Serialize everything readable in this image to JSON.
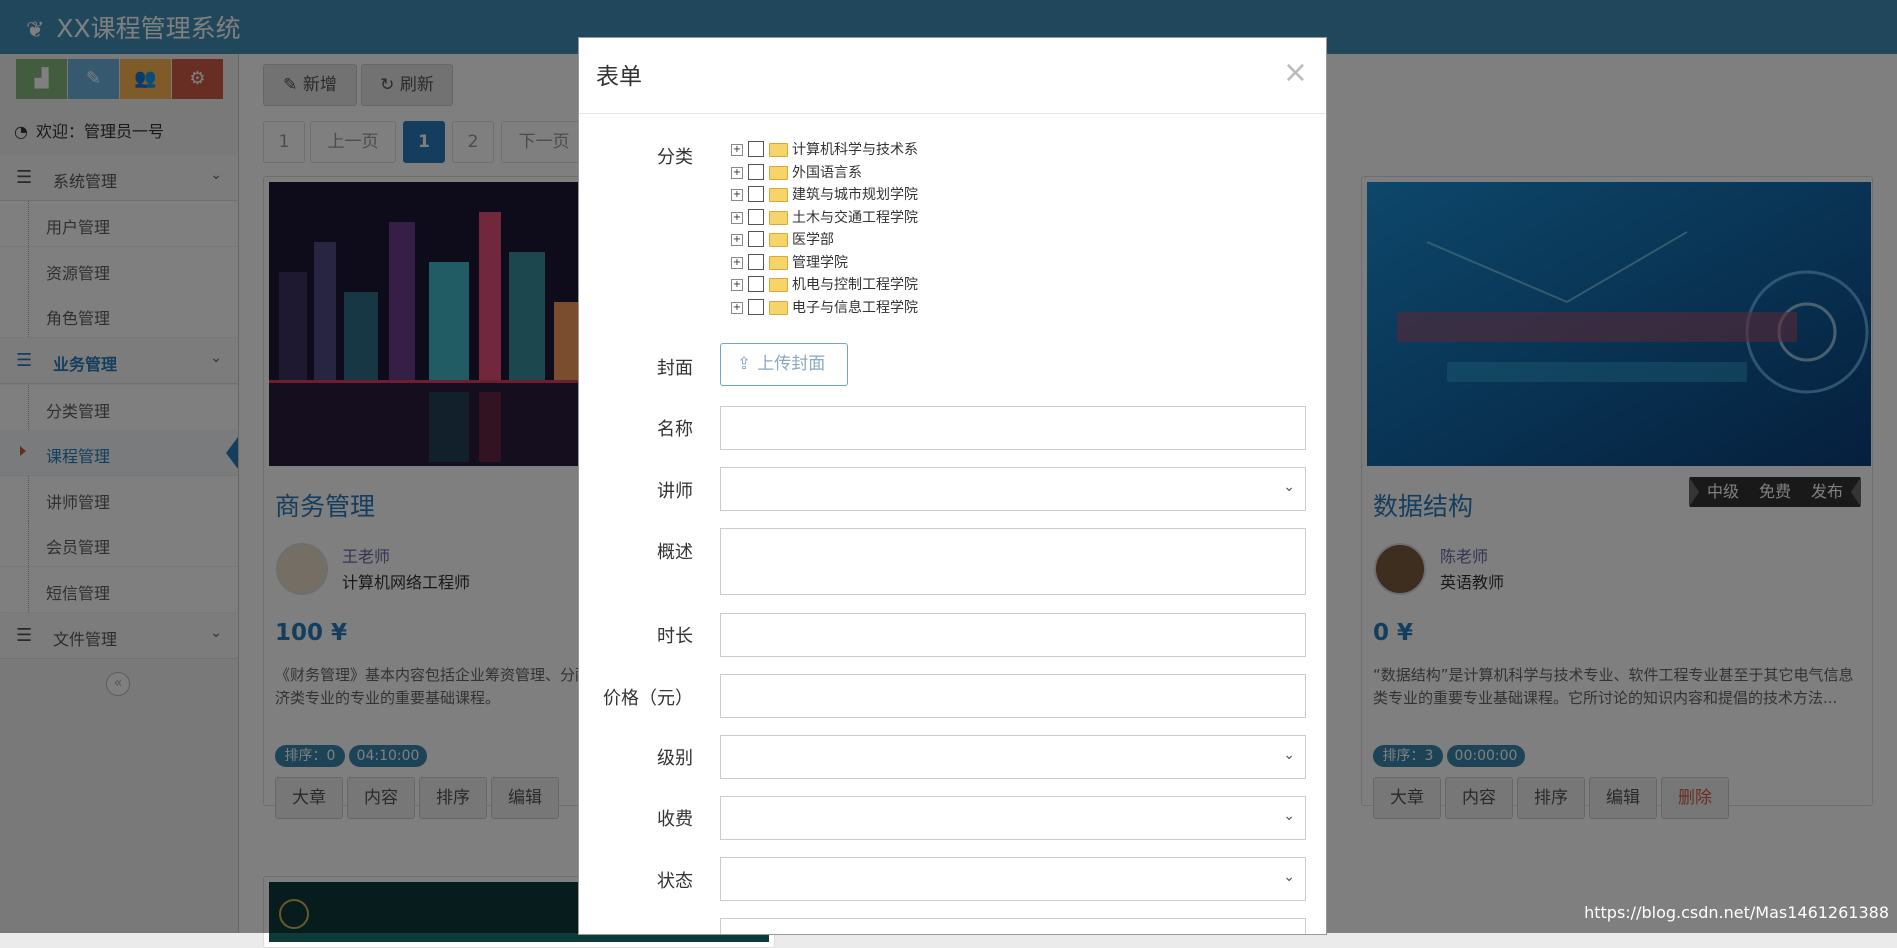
{
  "header": {
    "title": "XX课程管理系统"
  },
  "sidebar": {
    "welcome": "欢迎：管理员一号",
    "shortcut_colors": [
      "#87b87f",
      "#6fb3e0",
      "#ffb752",
      "#d15b47"
    ],
    "groups": [
      {
        "label": "系统管理",
        "items": [
          "用户管理",
          "资源管理",
          "角色管理"
        ]
      },
      {
        "label": "业务管理",
        "items": [
          "分类管理",
          "课程管理",
          "讲师管理",
          "会员管理",
          "短信管理"
        ]
      },
      {
        "label": "文件管理",
        "items": []
      }
    ],
    "active_item": "课程管理"
  },
  "toolbar": {
    "add_label": "新增",
    "refresh_label": "刷新"
  },
  "pagination": {
    "first": "1",
    "prev": "上一页",
    "current": "1",
    "page2": "2",
    "next": "下一页"
  },
  "courses": [
    {
      "title": "商务管理",
      "teacher_name": "王老师",
      "teacher_title": "计算机网络工程师",
      "price": "100 ¥",
      "desc": "《财务管理》基本内容包括企业筹资管理、分配管理等内容。本课程是经济类专业的专业的重要基础课程。",
      "sort_badge": "排序：0",
      "time_badge": "04:10:00",
      "actions": [
        "大章",
        "内容",
        "排序",
        "编辑"
      ]
    },
    {
      "title": "数据结构",
      "teacher_name": "陈老师",
      "teacher_title": "英语教师",
      "price": "0 ¥",
      "desc": "“数据结构”是计算机科学与技术专业、软件工程专业甚至于其它电气信息类专业的重要专业基础课程。它所讨论的知识内容和提倡的技术方法...",
      "sort_badge": "排序：3",
      "time_badge": "00:00:00",
      "ribbon": [
        "中级",
        "免费",
        "发布"
      ],
      "actions": [
        "大章",
        "内容",
        "排序",
        "编辑",
        "删除"
      ]
    }
  ],
  "modal": {
    "title": "表单",
    "close": "×",
    "labels": {
      "category": "分类",
      "cover": "封面",
      "name": "名称",
      "teacher": "讲师",
      "summary": "概述",
      "duration": "时长",
      "price": "价格（元）",
      "level": "级别",
      "charge": "收费",
      "status": "状态"
    },
    "upload_label": "上传封面",
    "category_tree": [
      "计算机科学与技术系",
      "外国语言系",
      "建筑与城市规划学院",
      "土木与交通工程学院",
      "医学部",
      "管理学院",
      "机电与控制工程学院",
      "电子与信息工程学院"
    ]
  },
  "watermark": "https://blog.csdn.net/Mas1461261388"
}
